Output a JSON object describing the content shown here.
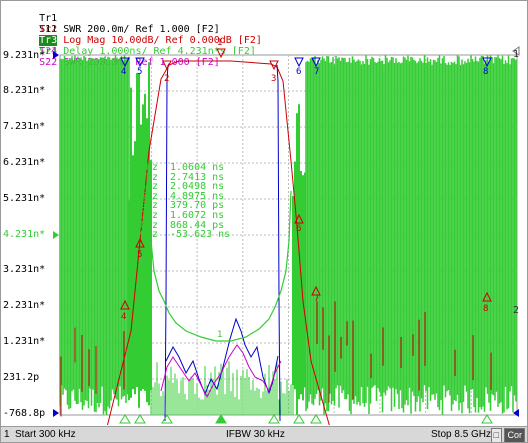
{
  "traces": [
    {
      "id": "Tr1",
      "desc": "S11 SWR 200.0m/ Ref 1.000 [F2]",
      "color": "#cc9900",
      "active": false
    },
    {
      "id": "Tr2",
      "desc": "S21 Log Mag 10.00dB/ Ref 0.000dB [F2]",
      "color": "#cc0000",
      "active": false
    },
    {
      "id": "Tr3",
      "desc": "S21 Delay 1.000ns/ Ref 4.231n*s [F2]",
      "color": "#33cc33",
      "active": true
    },
    {
      "id": "Tr4",
      "desc": "S22 SWR 200.0m/ Ref 1.000 [F2]",
      "color": "#cc00cc",
      "active": false
    }
  ],
  "y_labels": [
    "9.231n*",
    "8.231n*",
    "7.231n*",
    "6.231n*",
    "5.231n*",
    "4.231n*",
    "3.231n*",
    "2.231n*",
    "1.231n*",
    "231.2p",
    "-768.8p"
  ],
  "ref_label": "4.231n*",
  "markers": [
    {
      "unit": "GHz",
      "value": "1.0604 ns"
    },
    {
      "unit": "GHz",
      "value": "2.7413 ns"
    },
    {
      "unit": "GHz",
      "value": "2.0498 ns"
    },
    {
      "unit": "GHz",
      "value": "4.8975 ns"
    },
    {
      "unit": "GHz",
      "value": "379.70 ps"
    },
    {
      "unit": "GHz",
      "value": "1.6072 ns"
    },
    {
      "unit": "GHz",
      "value": "868.44 ps"
    },
    {
      "unit": "GHz",
      "value": "-53.623 ns"
    }
  ],
  "marker_tags": {
    "tr3_top": [
      "4",
      "5",
      "6",
      "7",
      "8"
    ],
    "tr2_top": [
      "1",
      "2",
      "3"
    ],
    "tr2_mid": [
      "4",
      "5",
      "6",
      "7",
      "8"
    ],
    "right_labels": [
      "1",
      "2"
    ]
  },
  "status": {
    "channel": "1",
    "start": "Start 300 kHz",
    "ifbw": "IFBW 30 kHz",
    "stop": "Stop 8.5 GHz",
    "corr": "Cor"
  },
  "colors": {
    "tr1": "#cc9900",
    "tr2": "#cc0000",
    "tr3": "#33cc33",
    "tr4": "#cc00cc",
    "tr_blue": "#0000cc",
    "grid": "#bdbdbd"
  }
}
